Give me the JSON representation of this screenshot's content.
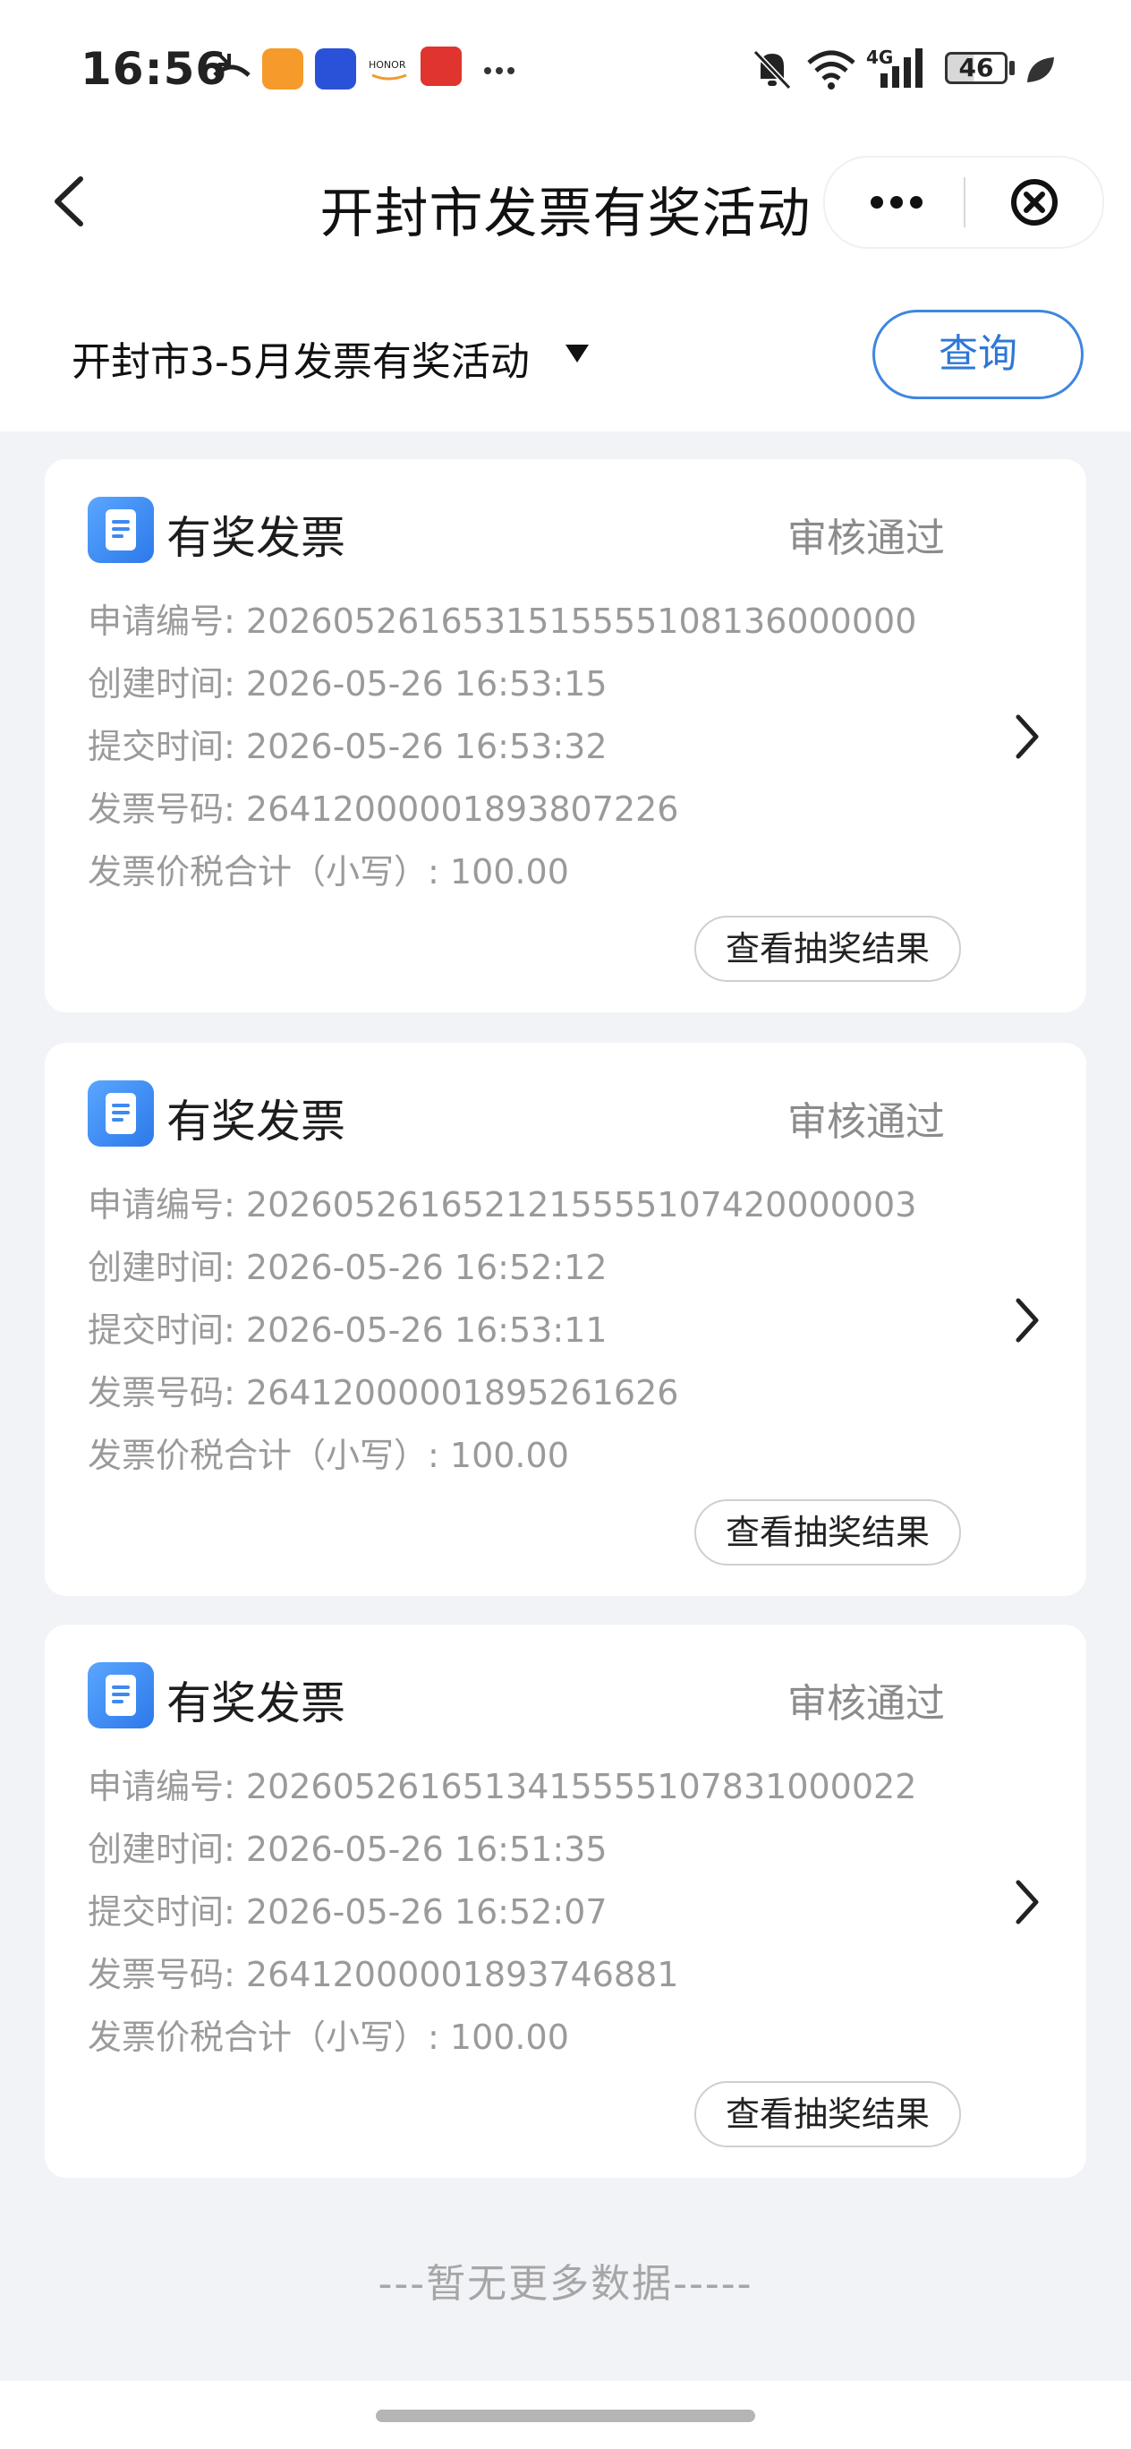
{
  "status_bar": {
    "time": "16:56",
    "network": "4G",
    "battery": "46",
    "icons": [
      "missed-call-icon",
      "app-heart-icon",
      "app-blue-icon",
      "honor-icon",
      "payment-icon",
      "more-dots-icon",
      "mute-bell-icon",
      "wifi-icon",
      "signal-icon",
      "battery-icon",
      "leaf-icon"
    ]
  },
  "nav": {
    "title": "开封市发票有奖活动",
    "icons": [
      "back-icon",
      "more-icon",
      "close-circle-icon"
    ]
  },
  "filter": {
    "selected_activity": "开封市3-5月发票有奖活动",
    "query_label": "查询"
  },
  "labels": {
    "app_no": "申请编号:",
    "created": "创建时间:",
    "submitted": "提交时间:",
    "invoice_no": "发票号码:",
    "amount": "发票价税合计（小写）:"
  },
  "cards": [
    {
      "title": "有奖发票",
      "status": "审核通过",
      "app_no": "2026052616531515555108136000000",
      "created": "2026-05-26 16:53:15",
      "submitted": "2026-05-26 16:53:32",
      "invoice_no": "26412000001893807226",
      "amount": "100.00",
      "button": "查看抽奖结果"
    },
    {
      "title": "有奖发票",
      "status": "审核通过",
      "app_no": "2026052616521215555107420000003",
      "created": "2026-05-26 16:52:12",
      "submitted": "2026-05-26 16:53:11",
      "invoice_no": "26412000001895261626",
      "amount": "100.00",
      "button": "查看抽奖结果"
    },
    {
      "title": "有奖发票",
      "status": "审核通过",
      "app_no": "2026052616513415555107831000022",
      "created": "2026-05-26 16:51:35",
      "submitted": "2026-05-26 16:52:07",
      "invoice_no": "26412000001893746881",
      "amount": "100.00",
      "button": "查看抽奖结果"
    }
  ],
  "footer": "---暂无更多数据-----",
  "colors": {
    "accent": "#2f77d6",
    "page_bg": "#f1f3f7",
    "status_text": "#8b8b8b"
  }
}
